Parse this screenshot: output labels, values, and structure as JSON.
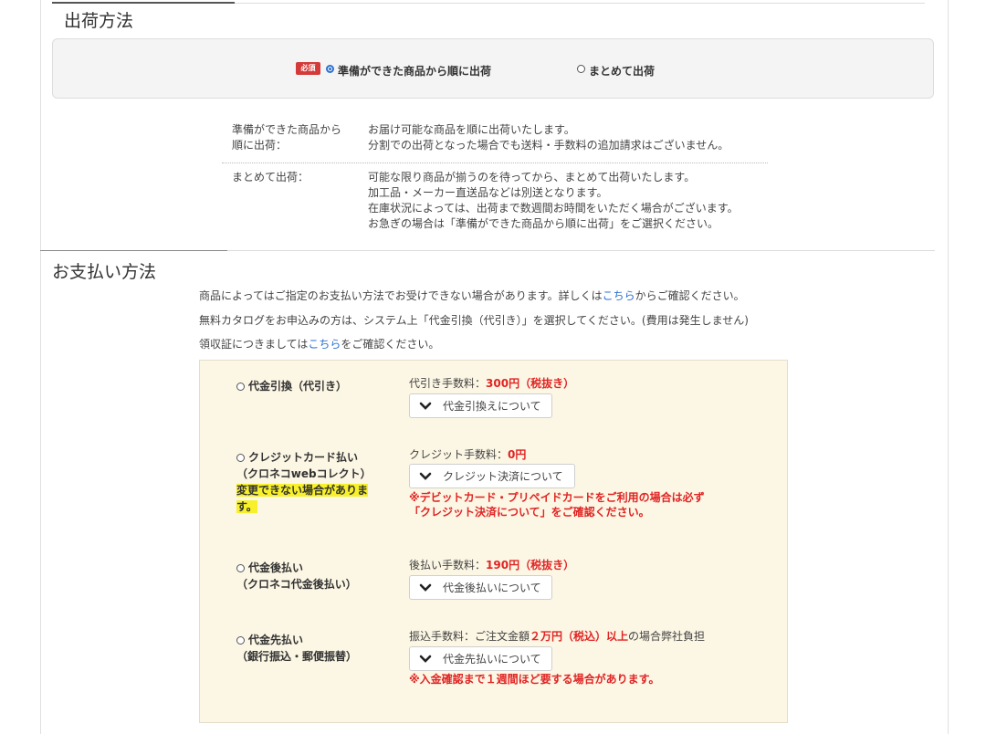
{
  "shipping": {
    "title": "出荷方法",
    "required_badge": "必須",
    "options": [
      "準備ができた商品から順に出荷",
      "まとめて出荷"
    ],
    "selected": "準備ができた商品から順に出荷",
    "descriptions": [
      {
        "term_line1": "準備ができた商品から",
        "term_line2": "順に出荷：",
        "line1": "お届け可能な商品を順に出荷いたします。",
        "line2": "分割での出荷となった場合でも送料・手数料の追加請求はございません。"
      },
      {
        "term_line1": "まとめて出荷：",
        "line1": "可能な限り商品が揃うのを待ってから、まとめて出荷いたします。",
        "line2": "加工品・メーカー直送品などは別送となります。",
        "line3": "在庫状況によっては、出荷まで数週間お時間をいただく場合がございます。",
        "line4": "お急ぎの場合は「準備ができた商品から順に出荷」をご選択ください。"
      }
    ]
  },
  "payment": {
    "title": "お支払い方法",
    "info1_a": "商品によってはご指定のお支払い方法でお受けできない場合があります。詳しくは",
    "info1_link": "こちら",
    "info1_b": "からご確認ください。",
    "info2": "無料カタログをお申込みの方は、システム上「代金引換（代引き）」を選択してください。(費用は発生しません)",
    "info3_a": "領収証につきましては",
    "info3_link": "こちら",
    "info3_b": "をご確認ください。",
    "methods": [
      {
        "label_line1": "代金引換（代引き）",
        "fee_label": "代引き手数料：",
        "fee_value": "300円（税抜き）",
        "button": "代金引換えについて"
      },
      {
        "label_line1": "クレジットカード払い",
        "label_line2": "（クロネコwebコレクト）",
        "highlight_line1": "変更できない場合がありま",
        "highlight_line2": "す。",
        "fee_label": "クレジット手数料：",
        "fee_value": "0円",
        "button": "クレジット決済について",
        "warning_line1": "※デビットカード・プリペイドカードをご利用の場合は必ず",
        "warning_line2": "「クレジット決済について」をご確認ください。"
      },
      {
        "label_line1": "代金後払い",
        "label_line2": "（クロネコ代金後払い）",
        "fee_label": "後払い手数料：",
        "fee_value": "190円（税抜き）",
        "button": "代金後払いについて"
      },
      {
        "label_line1": "代金先払い",
        "label_line2": "（銀行振込・郵便振替）",
        "fee_label": "振込手数料：ご注文金額",
        "fee_value": "２万円（税込）以上",
        "fee_suffix": "の場合弊社負担",
        "button": "代金先払いについて",
        "warning_line1": "※入金確認まで１週間ほど要する場合があります。"
      }
    ]
  },
  "colors": {
    "accent_red": "#e02424",
    "link_blue": "#2a6fd1",
    "payment_bg": "#fcf6e4",
    "highlight_yellow": "#f7f02a",
    "badge_red": "#d53a3a"
  },
  "icons": [
    "chevron-down-icon"
  ]
}
